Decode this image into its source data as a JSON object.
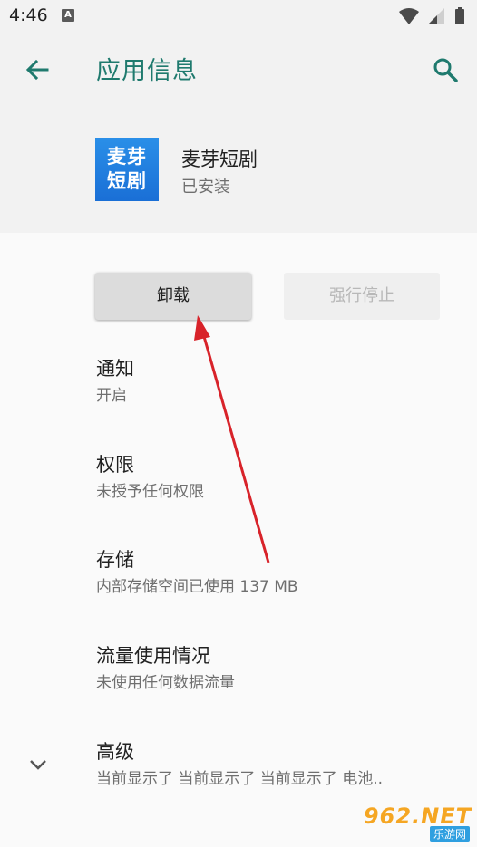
{
  "status_bar": {
    "time": "4:46",
    "notif_badge": "A",
    "icons": [
      "wifi-icon",
      "signal-icon",
      "battery-icon"
    ]
  },
  "appbar": {
    "title": "应用信息",
    "back_icon": "arrow-left-icon",
    "search_icon": "search-icon",
    "accent": "#1f7a6e"
  },
  "app": {
    "icon_line1": "麦芽",
    "icon_line2": "短剧",
    "name": "麦芽短剧",
    "status": "已安装",
    "icon_color": "#1a6fd6"
  },
  "buttons": {
    "uninstall": "卸载",
    "force_stop": "强行停止"
  },
  "settings": [
    {
      "title": "通知",
      "subtitle": "开启"
    },
    {
      "title": "权限",
      "subtitle": "未授予任何权限"
    },
    {
      "title": "存储",
      "subtitle": "内部存储空间已使用 137 MB"
    },
    {
      "title": "流量使用情况",
      "subtitle": "未使用任何数据流量"
    },
    {
      "title": "高级",
      "subtitle": "当前显示了 当前显示了 当前显示了 电池.."
    }
  ],
  "watermark": {
    "text": "962.NET",
    "sub": "乐游网"
  },
  "annotation": {
    "arrow_color": "#d8232a"
  }
}
